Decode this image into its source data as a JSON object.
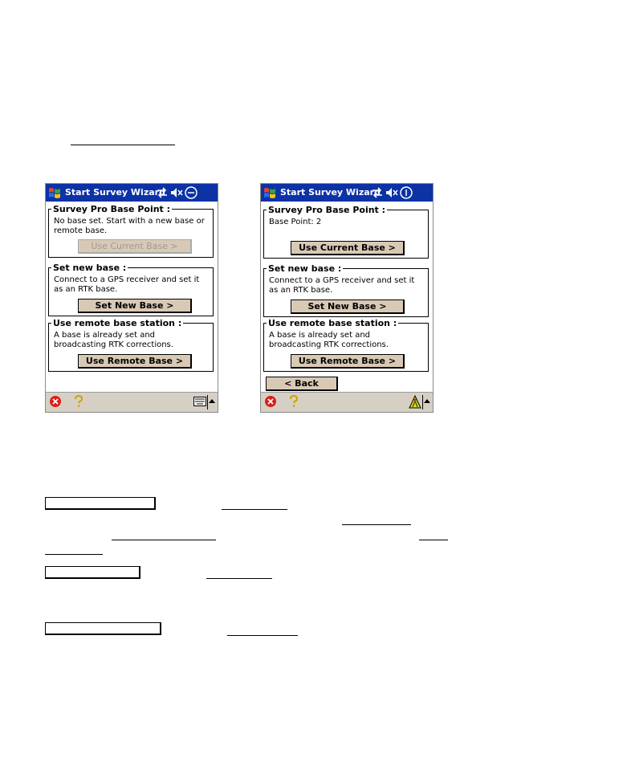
{
  "screen_left": {
    "title": "Start Survey Wizard",
    "group_base_point": {
      "title": "Survey Pro Base Point :",
      "description": "No base set. Start with a new base or remote base.",
      "button": "Use Current Base >"
    },
    "group_new_base": {
      "title": "Set new base :",
      "description": "Connect to a GPS receiver and set it as an RTK base.",
      "button": "Set New Base >"
    },
    "group_remote": {
      "title": "Use remote base station :",
      "description": "A base is already set and broadcasting RTK corrections.",
      "button": "Use Remote Base >"
    }
  },
  "screen_right": {
    "title": "Start Survey Wizard",
    "group_base_point": {
      "title": "Survey Pro Base Point :",
      "description": "Base Point: 2",
      "button": "Use Current Base >"
    },
    "group_new_base": {
      "title": "Set new base :",
      "description": "Connect to a GPS receiver and set it as an RTK base.",
      "button": "Set New Base >"
    },
    "group_remote": {
      "title": "Use remote base station :",
      "description": "A base is already set and broadcasting RTK corrections.",
      "button": "Use Remote Base >"
    },
    "back_button": "< Back"
  },
  "icons": {
    "windows_logo": "windows-flag-icon",
    "connectivity": "connectivity-arrows-icon",
    "speaker": "speaker-muted-icon",
    "close": "close-circle-icon",
    "help": "help-question-icon",
    "keyboard": "keyboard-icon",
    "sip_arrow": "up-arrow-icon",
    "gps_status": "gps-status-icon"
  },
  "colors": {
    "titlebar": "#0c32a6",
    "button_face": "#d8c9b5",
    "taskbar": "#d6d0c4"
  }
}
